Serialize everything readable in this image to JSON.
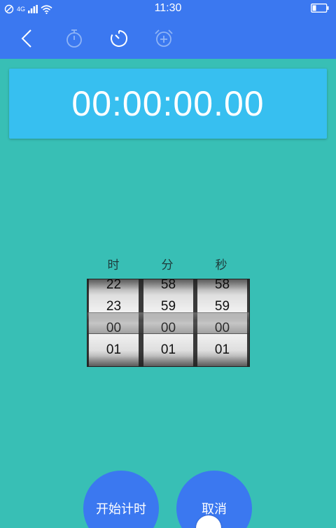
{
  "status_bar": {
    "time": "11:30",
    "network_label": "4G",
    "icons": [
      "no-disturb-icon",
      "signal-icon",
      "wifi-icon",
      "battery-icon"
    ]
  },
  "toolbar": {
    "back_icon": "chevron-left-icon",
    "tabs": [
      {
        "icon": "stopwatch-icon",
        "active": false
      },
      {
        "icon": "timer-icon",
        "active": true
      },
      {
        "icon": "alarm-add-icon",
        "active": false
      }
    ]
  },
  "display": {
    "time": "00:00:00.00"
  },
  "picker": {
    "columns": [
      {
        "label": "时",
        "values": [
          "22",
          "23",
          "00",
          "01"
        ],
        "selected": "00"
      },
      {
        "label": "分",
        "values": [
          "58",
          "59",
          "00",
          "01"
        ],
        "selected": "00"
      },
      {
        "label": "秒",
        "values": [
          "58",
          "59",
          "00",
          "01"
        ],
        "selected": "00"
      }
    ]
  },
  "buttons": {
    "start": "开始计时",
    "cancel": "取消"
  },
  "colors": {
    "primary": "#3b78f0",
    "background": "#38bfb5",
    "display": "#37bff0"
  }
}
